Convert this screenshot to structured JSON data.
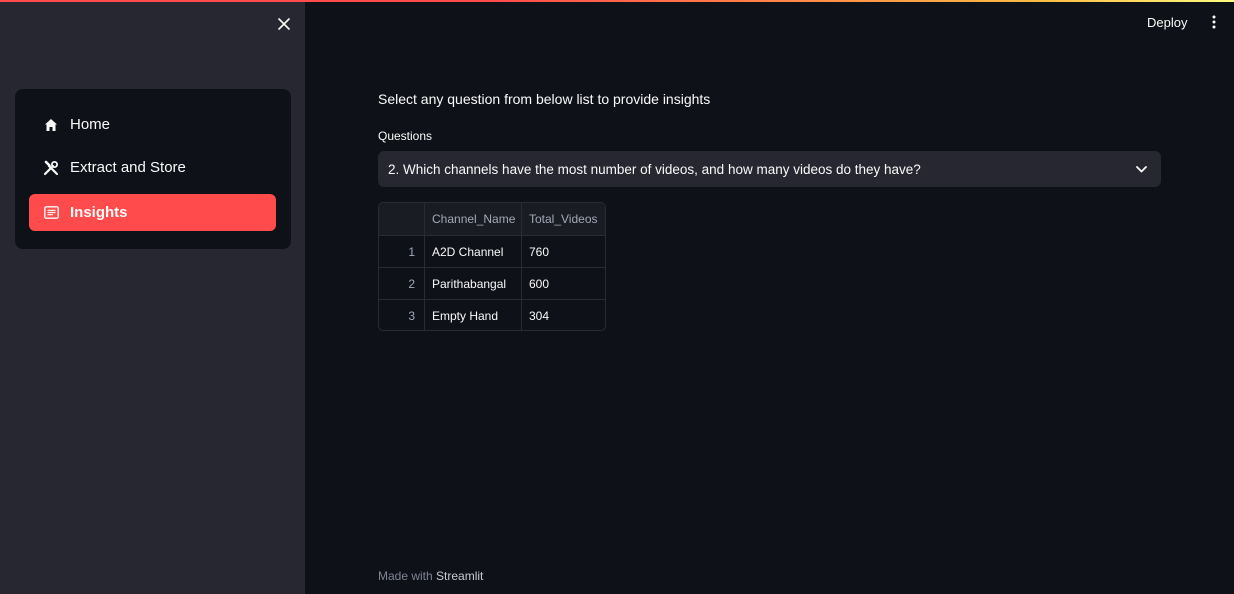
{
  "header": {
    "deploy_label": "Deploy",
    "menu_icon": "kebab-menu-icon"
  },
  "sidebar": {
    "close_icon": "close-icon",
    "items": [
      {
        "label": "Home",
        "icon": "home-icon",
        "active": false
      },
      {
        "label": "Extract and Store",
        "icon": "tools-icon",
        "active": false
      },
      {
        "label": "Insights",
        "icon": "list-icon",
        "active": true
      }
    ]
  },
  "main": {
    "heading": "Select any question from below list to provide insights",
    "select": {
      "label": "Questions",
      "value": "2. Which channels have the most number of videos, and how many videos do they have?"
    },
    "table": {
      "columns": [
        "",
        "Channel_Name",
        "Total_Videos"
      ],
      "rows": [
        [
          "1",
          "A2D Channel",
          "760"
        ],
        [
          "2",
          "Parithabangal",
          "600"
        ],
        [
          "3",
          "Empty Hand",
          "304"
        ]
      ]
    },
    "footer": {
      "prefix": "Made with",
      "brand": "Streamlit"
    }
  },
  "colors": {
    "accent": "#ff4b4b",
    "background": "#0e1117",
    "sidebar": "#262730"
  }
}
